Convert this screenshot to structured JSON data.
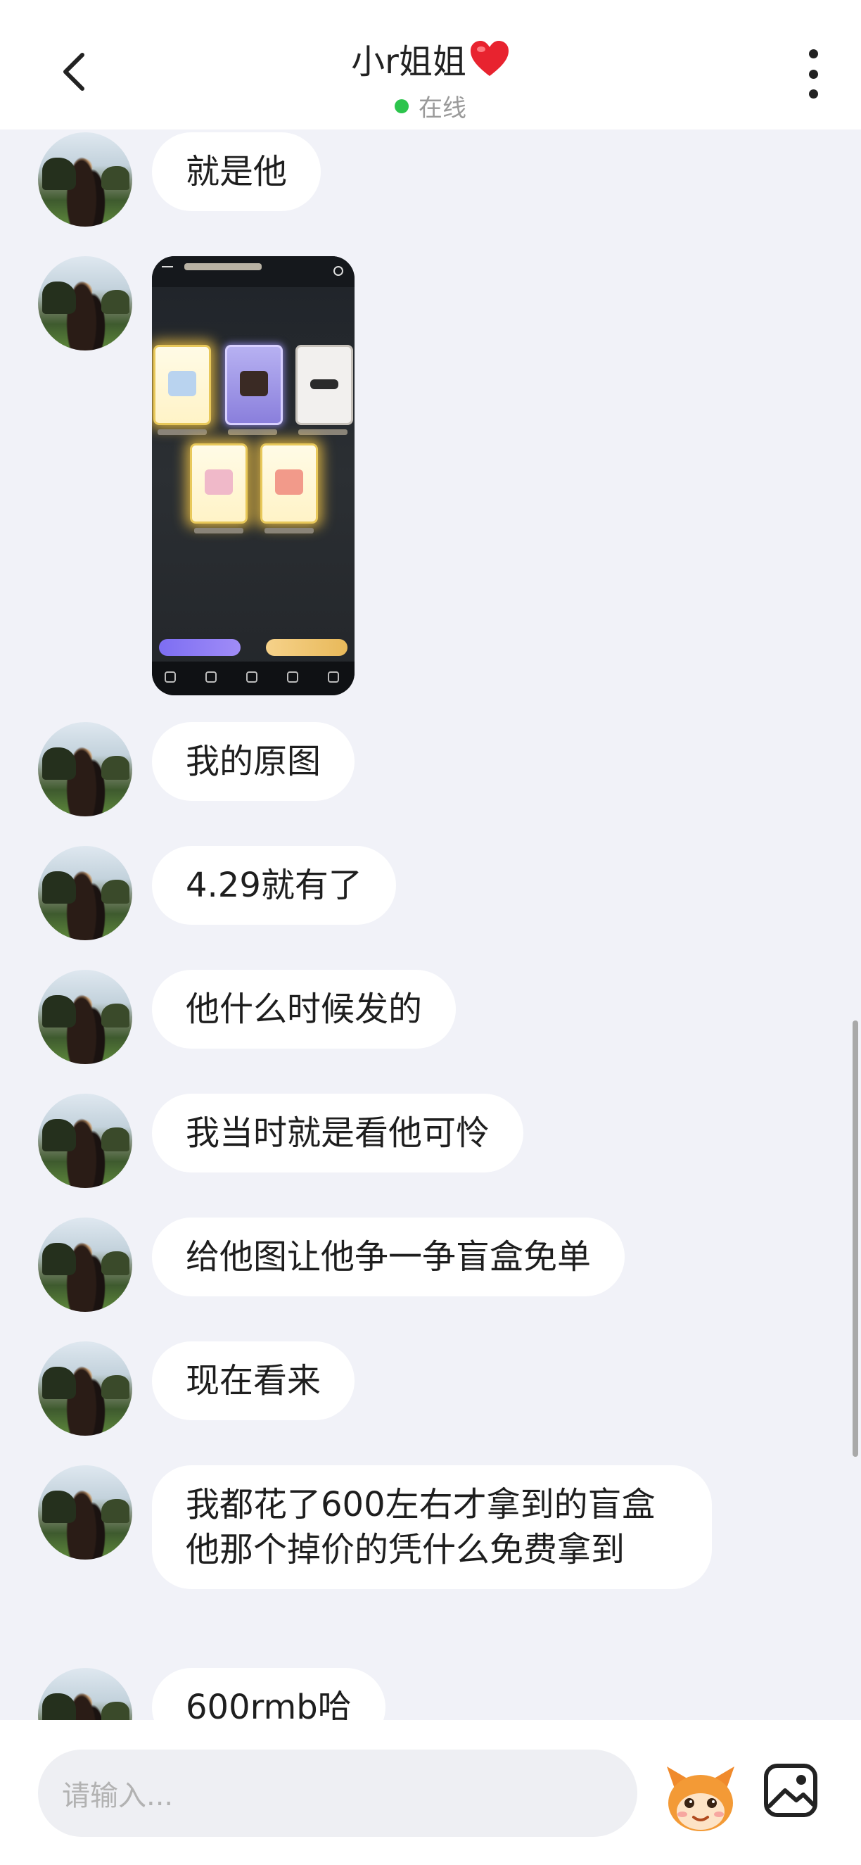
{
  "header": {
    "title": "小r姐姐",
    "status": "在线",
    "heart_color": "#e8232f",
    "status_color": "#2cc44c"
  },
  "messages": [
    {
      "type": "text",
      "text": "就是他"
    },
    {
      "type": "image"
    },
    {
      "type": "text",
      "text": "我的原图"
    },
    {
      "type": "text",
      "text": "4.29就有了"
    },
    {
      "type": "text",
      "text": "他什么时候发的"
    },
    {
      "type": "text",
      "text": "我当时就是看他可怜"
    },
    {
      "type": "text",
      "text": "给他图让他争一争盲盒免单"
    },
    {
      "type": "text",
      "text": "现在看来"
    },
    {
      "type": "text",
      "text": "我都花了600左右才拿到的盲盒他那个掉价的凭什么免费拿到"
    },
    {
      "type": "text",
      "text": "600rmb哈"
    }
  ],
  "input": {
    "placeholder": "请输入..."
  },
  "icons": {
    "back": "chevron-left-icon",
    "more": "more-vertical-icon",
    "emoji": "mascot-emoji-icon",
    "image": "image-icon"
  }
}
